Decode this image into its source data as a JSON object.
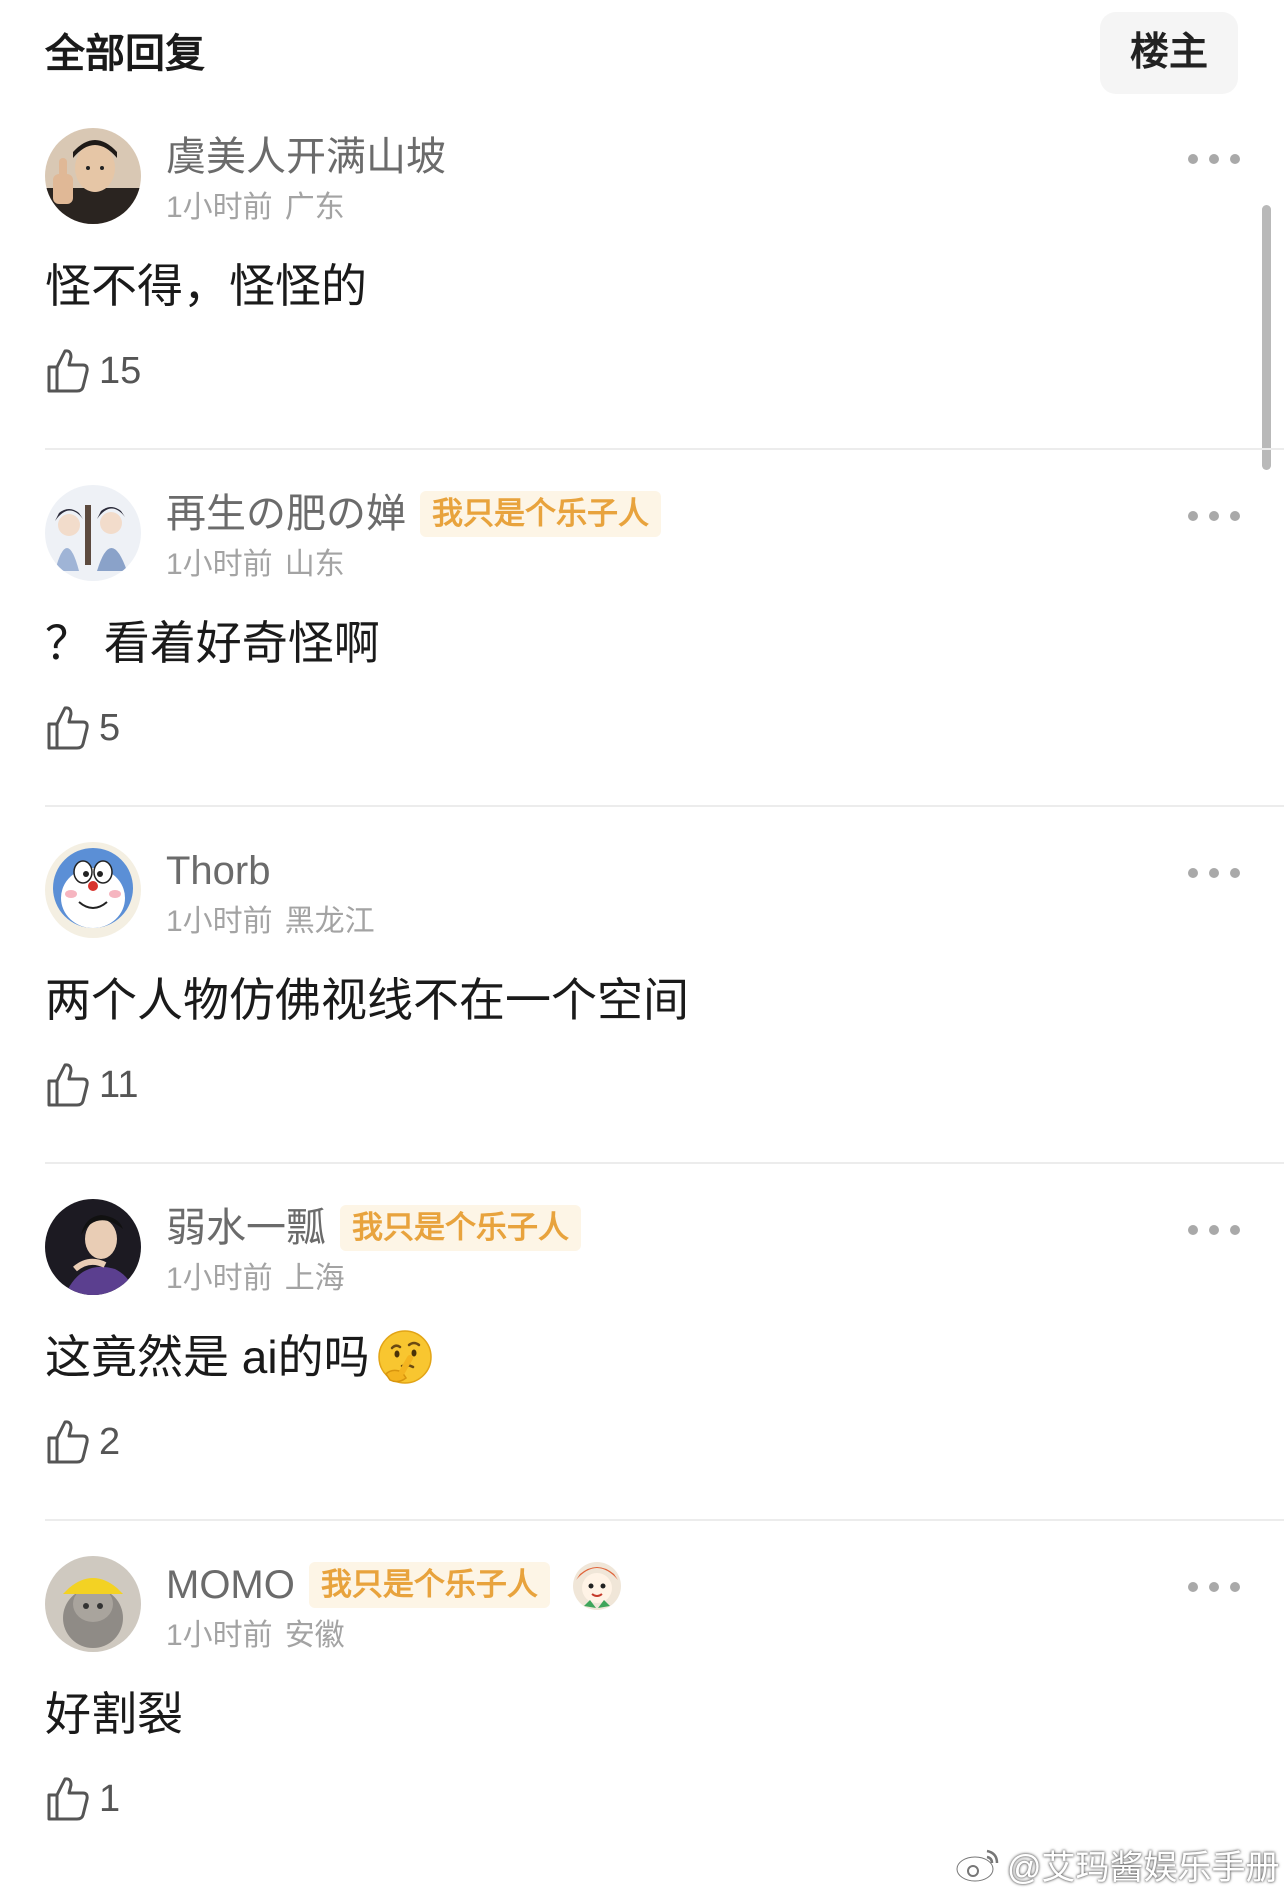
{
  "header": {
    "title": "全部回复",
    "filter_label": "楼主"
  },
  "comments": [
    {
      "username": "虞美人开满山坡",
      "badge": "",
      "time": "1小时前",
      "location": "广东",
      "text": "怪不得，怪怪的",
      "likes": "15"
    },
    {
      "username": "再生の肥の婵",
      "badge": "我只是个乐子人",
      "time": "1小时前",
      "location": "山东",
      "text": "？ 看着好奇怪啊",
      "likes": "5"
    },
    {
      "username": "Thorb",
      "badge": "",
      "time": "1小时前",
      "location": "黑龙江",
      "text": "两个人物仿佛视线不在一个空间",
      "likes": "11"
    },
    {
      "username": "弱水一瓢",
      "badge": "我只是个乐子人",
      "time": "1小时前",
      "location": "上海",
      "text": "这竟然是 ai的吗",
      "likes": "2",
      "emoji": "thinking-face"
    },
    {
      "username": "MOMO",
      "badge": "我只是个乐子人",
      "time": "1小时前",
      "location": "安徽",
      "text": "好割裂",
      "likes": "1",
      "badge_icon": "fan-mascot-icon"
    }
  ],
  "watermark": "@艾玛酱娱乐手册",
  "icons": {
    "like": "thumbs-up-outline-icon",
    "more": "more-dots-icon",
    "watermark": "weibo-logo-icon"
  },
  "colors": {
    "badge_text": "#e8a33d",
    "badge_bg": "#fdf5e6",
    "meta_text": "#a3a3a3",
    "username_text": "#6b6b6b"
  }
}
